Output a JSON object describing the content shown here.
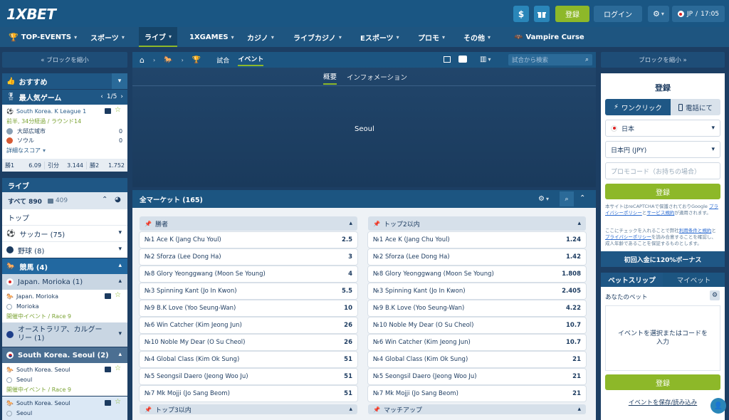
{
  "header": {
    "logo": "1XBET",
    "register": "登録",
    "login": "ログイン",
    "locale": "JP",
    "time": "17:05"
  },
  "nav": [
    {
      "label": "TOP-EVENTS",
      "icon": "trophy-icon"
    },
    {
      "label": "スポーツ"
    },
    {
      "label": "ライブ"
    },
    {
      "label": "1XGAMES"
    },
    {
      "label": "カジノ"
    },
    {
      "label": "ライブカジノ"
    },
    {
      "label": "Eスポーツ"
    },
    {
      "label": "プロモ"
    },
    {
      "label": "その他"
    },
    {
      "label": "Vampire Curse"
    }
  ],
  "left": {
    "collapse": "« ブロックを縮小",
    "favorites": "おすすめ",
    "popular": "最人気ゲーム",
    "pager": "1/5",
    "match": {
      "league": "South Korea. K League 1",
      "status": "前半, 34分経過 / ラウンド14",
      "team1": "大邱広域市",
      "score1": "0",
      "team2": "ソウル",
      "score2": "0",
      "details": "詳細なスコア",
      "odds": [
        {
          "label": "勝1",
          "value": "6.09"
        },
        {
          "label": "引分",
          "value": "3.144"
        },
        {
          "label": "勝2",
          "value": "1.752"
        }
      ]
    },
    "live": "ライブ",
    "all": "すべて 890",
    "video_count": "409",
    "top": "トップ",
    "soccer": "サッカー (75)",
    "baseball": "野球 (8)",
    "horse": "競馬 (4)",
    "japan_morioka": "Japan. Morioka (1)",
    "ev1": {
      "league": "Japan. Morioka",
      "venue": "Morioka",
      "status": "開催中イベント / Race 9"
    },
    "australia": "オーストラリア、カルグーリー (1)",
    "korea": "South Korea. Seoul (2)",
    "ev2": {
      "league": "South Korea. Seoul",
      "venue": "Seoul",
      "status": "開催中イベント / Race 9"
    },
    "ev3": {
      "league": "South Korea. Seoul",
      "venue": "Seoul"
    }
  },
  "center": {
    "crumb_tabs": [
      "試合",
      "イベント"
    ],
    "search_placeholder": "試合から検索",
    "info_tabs": [
      "概要",
      "インフォメーション"
    ],
    "banner_text": "Seoul",
    "markets_title": "全マーケット (165)",
    "left_market": {
      "title": "勝者",
      "rows": [
        {
          "name": "№1 Ace K (Jang Chu Youl)",
          "odd": "2.5"
        },
        {
          "name": "№2 Sforza (Lee Dong Ha)",
          "odd": "3"
        },
        {
          "name": "№8 Glory Yeonggwang (Moon Se Young)",
          "odd": "4"
        },
        {
          "name": "№3 Spinning Kant (Jo In Kwon)",
          "odd": "5.5"
        },
        {
          "name": "№9 B.K Love (Yoo Seung-Wan)",
          "odd": "10"
        },
        {
          "name": "№6 Win Catcher (Kim Jeong Jun)",
          "odd": "26"
        },
        {
          "name": "№10 Noble My Dear (O Su Cheol)",
          "odd": "26"
        },
        {
          "name": "№4 Global Class (Kim Ok Sung)",
          "odd": "51"
        },
        {
          "name": "№5 Seongsil Daero (Jeong Woo Ju)",
          "odd": "51"
        },
        {
          "name": "№7 Mk Mojji (Jo Sang Beom)",
          "odd": "51"
        }
      ],
      "next": "トップ3以内"
    },
    "right_market": {
      "title": "トップ2以内",
      "rows": [
        {
          "name": "№1 Ace K (Jang Chu Youl)",
          "odd": "1.24"
        },
        {
          "name": "№2 Sforza (Lee Dong Ha)",
          "odd": "1.42"
        },
        {
          "name": "№8 Glory Yeonggwang (Moon Se Young)",
          "odd": "1.808"
        },
        {
          "name": "№3 Spinning Kant (Jo In Kwon)",
          "odd": "2.405"
        },
        {
          "name": "№9 B.K Love (Yoo Seung-Wan)",
          "odd": "4.22"
        },
        {
          "name": "№10 Noble My Dear (O Su Cheol)",
          "odd": "10.7"
        },
        {
          "name": "№6 Win Catcher (Kim Jeong Jun)",
          "odd": "10.7"
        },
        {
          "name": "№4 Global Class (Kim Ok Sung)",
          "odd": "21"
        },
        {
          "name": "№5 Seongsil Daero (Jeong Woo Ju)",
          "odd": "21"
        },
        {
          "name": "№7 Mk Mojji (Jo Sang Beom)",
          "odd": "21"
        }
      ],
      "next": "マッチアップ"
    }
  },
  "right": {
    "collapse": "ブロックを縮小 »",
    "reg_title": "登録",
    "tab_oneclick": "ワンクリック",
    "tab_phone": "電話にて",
    "country": "日本",
    "currency": "日本円 (JPY)",
    "promo_placeholder": "プロモコード（お持ちの場合）",
    "register_btn": "登録",
    "recaptcha_1": "本サイトはreCAPTCHAで保護されておりGoogle ",
    "recaptcha_link1": "プライバシーポリシー",
    "recaptcha_2": "と",
    "recaptcha_link2": "サービス規約",
    "recaptcha_3": "が適用されます。",
    "terms_1": "ここにチェックを入れることで弊社",
    "terms_link1": "利用条件と規約",
    "terms_2": "と",
    "terms_link2": "プライバシーポリシー",
    "terms_3": "を読み合意することを確認し、成人年齢であることを保証するものとします。",
    "bonus": "初回入金に120%ボーナス",
    "betslip_tab": "ベットスリップ",
    "mybets_tab": "マイベット",
    "your_bet": "あなたのベット",
    "empty_msg": "イベントを選択またはコードを入力",
    "register_btn2": "登録",
    "save_load": "イベントを保存/読み込み"
  },
  "colors": {
    "accent_green": "#8db829",
    "header_blue": "#1a5683",
    "panel_blue": "#1f5785"
  }
}
